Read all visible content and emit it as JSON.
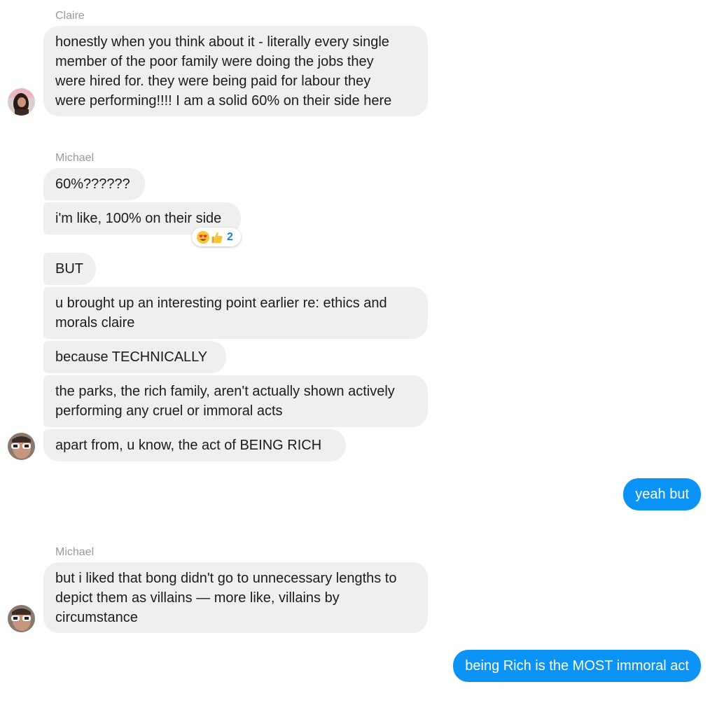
{
  "groups": [
    {
      "sender": "Claire",
      "messages": [
        "honestly when you think about it - literally every single\nmember of the poor family were doing the jobs they\nwere hired for. they were being paid for labour they\nwere performing!!!! I am a solid 60% on their side here"
      ]
    },
    {
      "sender": "Michael",
      "messages": [
        "60%??????",
        "i'm like, 100% on their side",
        "BUT",
        "u brought up an interesting point earlier re: ethics and\nmorals claire",
        "because TECHNICALLY",
        "the parks, the rich family, aren't actually shown actively\nperforming any cruel or immoral acts",
        "apart from, u know, the act of BEING RICH"
      ],
      "reaction": {
        "emojis": [
          "heart-eyes",
          "thumbs-up"
        ],
        "count": "2"
      }
    },
    {
      "sender": "",
      "messages": [
        "yeah but"
      ]
    },
    {
      "sender": "Michael",
      "messages": [
        "but i liked that bong didn't go to unnecessary lengths to\ndepict them as villains — more like, villains by\ncircumstance"
      ]
    },
    {
      "sender": "",
      "messages": [
        "being Rich is the MOST immoral act"
      ]
    }
  ],
  "colors": {
    "incoming_bubble": "#f0eff0",
    "outgoing_bubble": "#0b93f6",
    "sender_name": "#9a9a9a",
    "reaction_count": "#0b85e6"
  }
}
